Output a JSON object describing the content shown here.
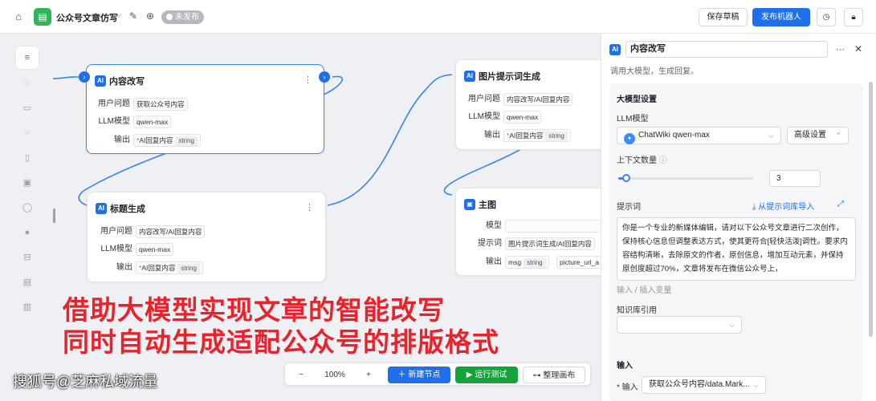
{
  "topbar": {
    "app_title": "公众号文章仿写",
    "status_badge": "未发布",
    "save_draft_label": "保存草稿",
    "publish_label": "发布机器人"
  },
  "nodes": {
    "content_rewrite": {
      "title": "内容改写",
      "user_question_label": "用户问题",
      "user_question_value": "获取公众号内容",
      "llm_label": "LLM模型",
      "llm_value": "qwen-max",
      "output_label": "输出",
      "output_value": "AI回复内容",
      "output_type": "string"
    },
    "title_gen": {
      "title": "标题生成",
      "user_question_label": "用户问题",
      "user_question_value": "内容改写/AI回复内容",
      "llm_label": "LLM模型",
      "llm_value": "qwen-max",
      "output_label": "输出",
      "output_value": "AI回复内容",
      "output_type": "string"
    },
    "image_prompt": {
      "title": "图片提示词生成",
      "user_question_label": "用户问题",
      "user_question_value": "内容改写/AI回复内容",
      "llm_label": "LLM模型",
      "llm_value": "qwen-max",
      "output_label": "输出",
      "output_value": "AI回复内容",
      "output_type": "string"
    },
    "main_image": {
      "title": "主图",
      "model_label": "模型",
      "model_value": "",
      "prompt_label": "提示词",
      "prompt_value": "图片提示词生成/AI回复内容",
      "output_label": "输出",
      "output_value": "msg",
      "output_type": "string",
      "output_value2": "picture_url_a"
    }
  },
  "caption": {
    "line1": "借助大模型实现文章的智能改写",
    "line2": "同时自动生成适配公众号的排版格式"
  },
  "watermark": "搜狐号@芝麻私域流量",
  "toolbar": {
    "zoom": "100%",
    "new_node": "新建节点",
    "run_test": "运行测试",
    "arrange": "整理画布"
  },
  "panel": {
    "node_name": "内容改写",
    "description": "调用大模型，生成回复。",
    "llm_section_title": "大模型设置",
    "llm_model_label": "LLM模型",
    "llm_model_value": "ChatWiki qwen-max",
    "advanced_label": "高级设置",
    "context_count_label": "上下文数量",
    "context_count_value": "3",
    "context_slider_fraction": 0.06,
    "prompt_label": "提示词",
    "import_link": "从提示词库导入",
    "prompt_text": "你是一个专业的新媒体编辑，请对以下公众号文章进行二次创作，保持核心信息但调整表达方式，使其更符合[轻快活泼]调性。要求内容结构清晰，去除原文的作者，原创信息，增加互动元素，并保持原创度超过70%，文章将发布在微信公众号上，",
    "insert_var_hint": "输入 / 插入变量",
    "knowledge_label": "知识库引用",
    "input_section_title": "输入",
    "input_label": "* 输入",
    "input_value": "获取公众号内容/data.Mark..."
  },
  "colors": {
    "primary": "#1f6feb",
    "run_green": "#14a33b",
    "caption_red": "#e8232b",
    "app_logo_green": "#2fb559"
  }
}
